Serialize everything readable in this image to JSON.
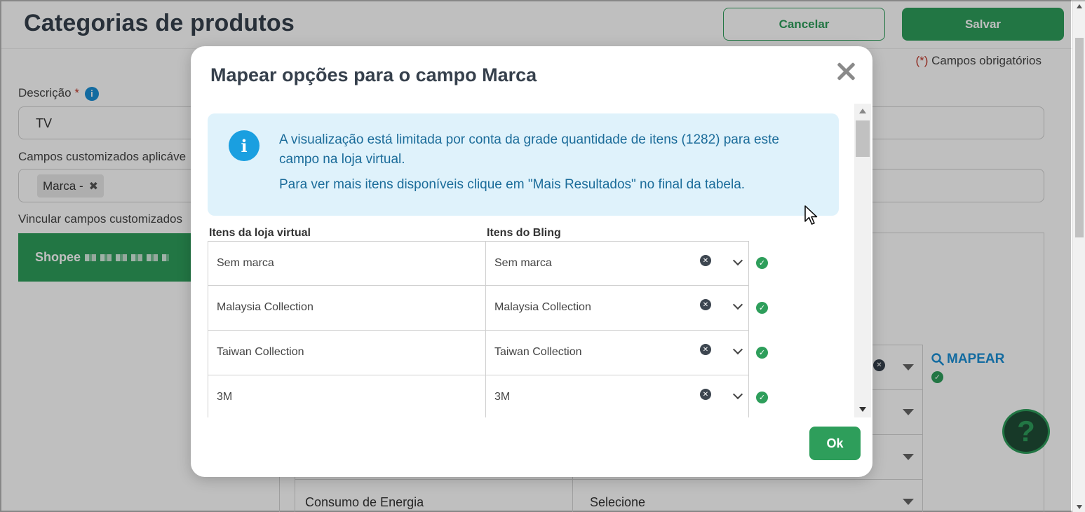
{
  "page": {
    "title": "Categorias de produtos",
    "cancel_label": "Cancelar",
    "save_label": "Salvar",
    "required_note_mark": "(*)",
    "required_note_text": " Campos obrigatórios",
    "description_label": "Descrição",
    "description_value": "TV",
    "custom_fields_label": "Campos customizados aplicáve",
    "tag_label": "Marca -",
    "link_fields_label": "Vincular campos customizados",
    "store_tab_label": "Shopee",
    "bg_rows": [
      {
        "name": "",
        "value": ""
      },
      {
        "name": "",
        "value": ""
      },
      {
        "name": "",
        "value": ""
      },
      {
        "name": "Consumo de Energia",
        "value": "Selecione"
      }
    ],
    "mapear_label": "MAPEAR",
    "help_label": "?"
  },
  "modal": {
    "title": "Mapear opções para o campo Marca",
    "alert_line1": "A visualização está limitada por conta da grade quantidade de itens (1282) para este campo na loja virtual.",
    "alert_line2": "Para ver mais itens disponíveis clique em \"Mais Resultados\" no final da tabela.",
    "col_store": "Itens da loja virtual",
    "col_bling": "Itens do Bling",
    "rows": [
      {
        "store": "Sem marca",
        "bling": "Sem marca"
      },
      {
        "store": "Malaysia Collection",
        "bling": "Malaysia Collection"
      },
      {
        "store": "Taiwan Collection",
        "bling": "Taiwan Collection"
      },
      {
        "store": "3M",
        "bling": "3M"
      }
    ],
    "ok_label": "Ok"
  },
  "colors": {
    "primary_green": "#2e9e5b",
    "info_blue": "#1a9fe0",
    "alert_bg": "#dff2fb",
    "title_dark": "#36404c"
  },
  "icons": {
    "info": "info-circle-icon",
    "close": "close-x-icon",
    "clear": "clear-circle-icon",
    "dropdown": "chevron-down-icon",
    "check": "check-circle-icon",
    "search": "magnifier-icon",
    "help": "question-icon"
  }
}
